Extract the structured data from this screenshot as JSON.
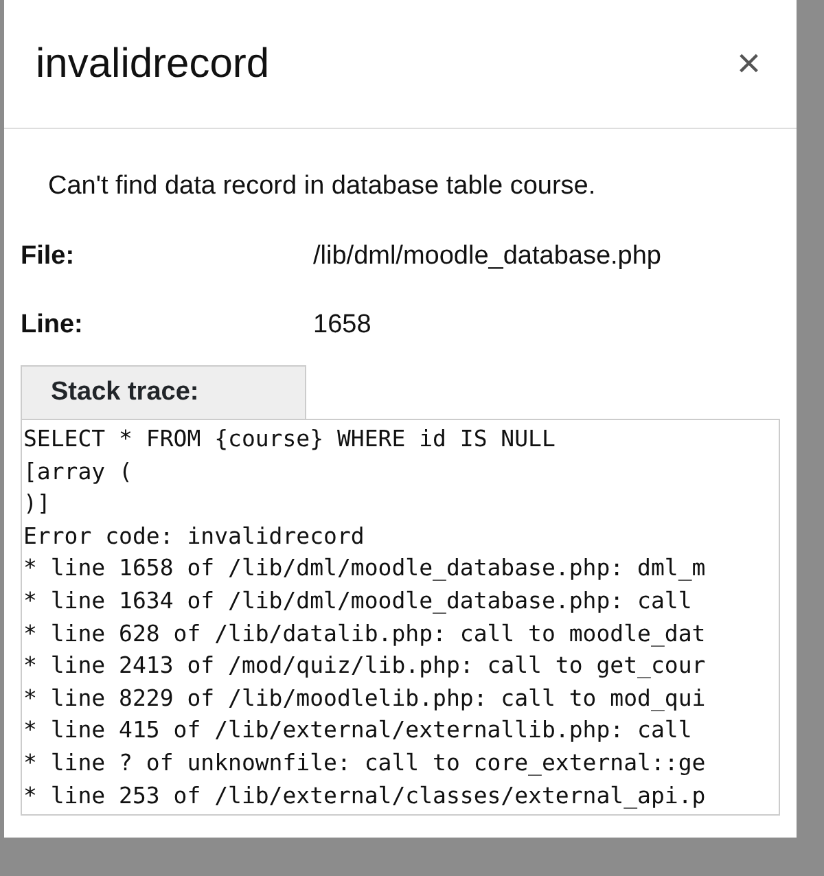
{
  "dialog": {
    "title": "invalidrecord",
    "close_label": "×",
    "message": "Can't find data record in database table course.",
    "details": [
      {
        "label": "File:",
        "value": "/lib/dml/moodle_database.php"
      },
      {
        "label": "Line:",
        "value": "1658"
      }
    ],
    "stack_trace": {
      "label": "Stack trace:",
      "lines": [
        "SELECT * FROM {course} WHERE id IS NULL",
        "[array (",
        ")]",
        "Error code: invalidrecord",
        "* line 1658 of /lib/dml/moodle_database.php: dml_m",
        "* line 1634 of /lib/dml/moodle_database.php: call",
        "* line 628 of /lib/datalib.php: call to moodle_dat",
        "* line 2413 of /mod/quiz/lib.php: call to get_cour",
        "* line 8229 of /lib/moodlelib.php: call to mod_qui",
        "* line 415 of /lib/external/externallib.php: call",
        "* line ? of unknownfile: call to core_external::ge",
        "* line 253 of /lib/external/classes/external_api.p"
      ]
    }
  }
}
